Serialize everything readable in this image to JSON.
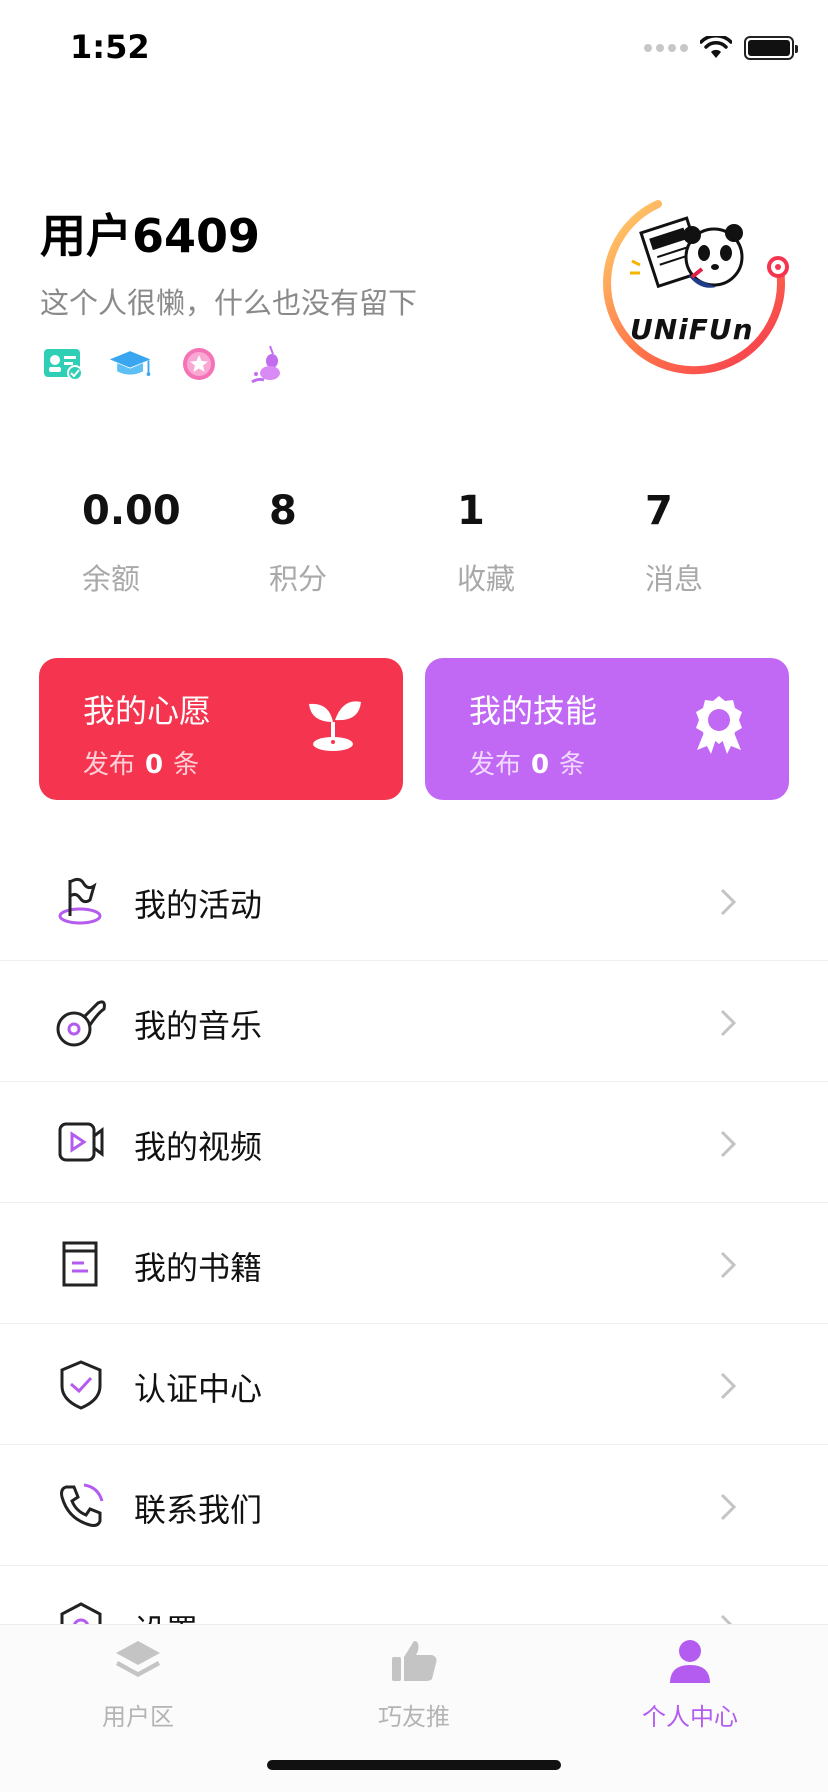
{
  "status": {
    "time": "1:52"
  },
  "profile": {
    "username": "用户6409",
    "bio": "这个人很懒，什么也没有留下",
    "badges": [
      "id-card-verified-icon",
      "graduation-cap-icon",
      "star-medal-icon",
      "unicorn-icon"
    ],
    "avatar_text": "UNiFUn"
  },
  "stats": [
    {
      "value": "0.00",
      "label": "余额"
    },
    {
      "value": "8",
      "label": "积分"
    },
    {
      "value": "1",
      "label": "收藏"
    },
    {
      "value": "7",
      "label": "消息"
    }
  ],
  "cards": {
    "wish": {
      "title": "我的心愿",
      "prefix": "发布",
      "count": "0",
      "suffix": "条",
      "color": "#f5344f"
    },
    "skill": {
      "title": "我的技能",
      "prefix": "发布",
      "count": "0",
      "suffix": "条",
      "color": "#c168f4"
    }
  },
  "menu": [
    {
      "label": "我的活动",
      "icon": "flag-icon"
    },
    {
      "label": "我的音乐",
      "icon": "music-disc-icon"
    },
    {
      "label": "我的视频",
      "icon": "video-icon"
    },
    {
      "label": "我的书籍",
      "icon": "book-icon"
    },
    {
      "label": "认证中心",
      "icon": "shield-check-icon"
    },
    {
      "label": "联系我们",
      "icon": "phone-icon"
    },
    {
      "label": "设置",
      "icon": "settings-icon"
    }
  ],
  "tabs": [
    {
      "label": "用户区",
      "icon": "layers-icon"
    },
    {
      "label": "巧友推",
      "icon": "thumbs-up-icon"
    },
    {
      "label": "个人中心",
      "icon": "person-icon"
    }
  ],
  "colors": {
    "accent": "#b55cf0",
    "wish": "#f5344f",
    "skill": "#c168f4"
  }
}
